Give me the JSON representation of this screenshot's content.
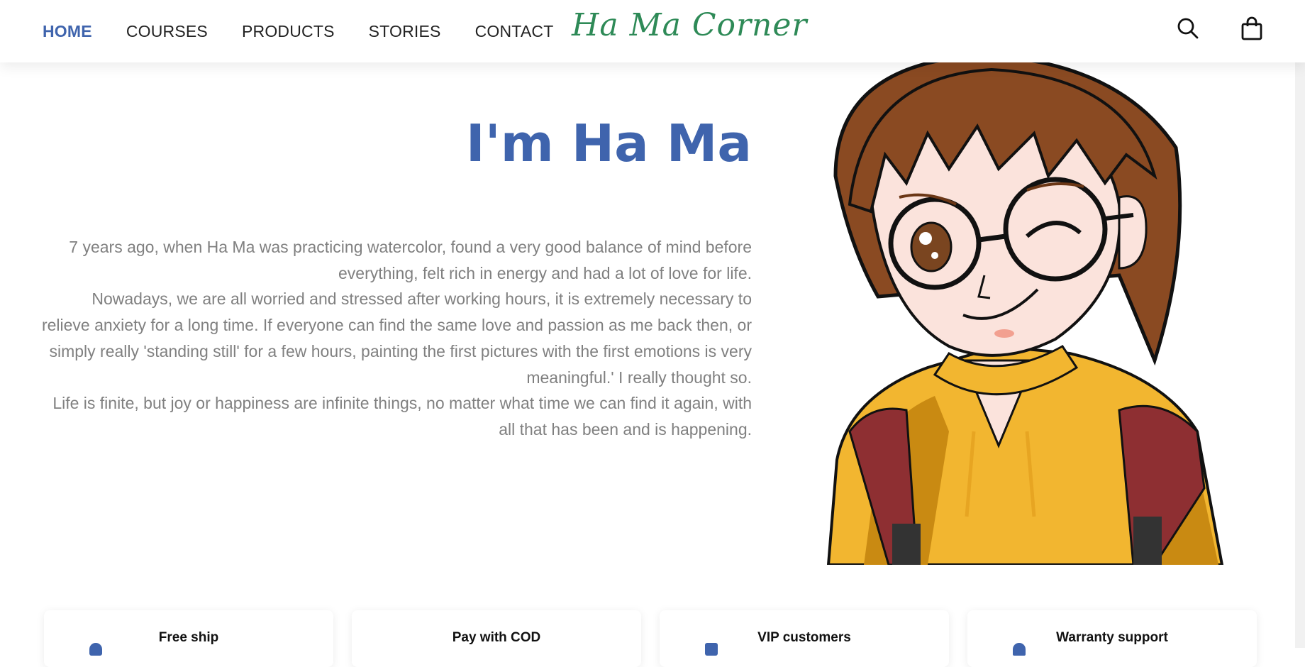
{
  "nav": {
    "items": [
      {
        "label": "HOME",
        "active": true
      },
      {
        "label": "COURSES"
      },
      {
        "label": "PRODUCTS"
      },
      {
        "label": "STORIES"
      },
      {
        "label": "CONTACT"
      }
    ]
  },
  "brand": {
    "logo_text": "Ha Ma Corner",
    "accent_color": "#3f64ad",
    "logo_color": "#2e8a57"
  },
  "header": {
    "icons": [
      "search-icon",
      "shopping-bag-icon"
    ]
  },
  "hero": {
    "title": "I'm Ha Ma",
    "paragraphs": [
      "7 years ago, when Ha Ma was practicing watercolor, found a very good balance of mind before everything, felt rich in energy and had a lot of love for life.",
      "Nowadays, we are all worried and stressed after working hours, it is extremely necessary to relieve anxiety for a long time. If everyone can find the same love and passion as me back then, or simply really 'standing still' for a few hours, painting the first pictures with the first emotions is very meaningful.' I really thought so.",
      "Life is finite, but joy or happiness are infinite things, no matter what time we can find it again, with all that has been and is happening."
    ]
  },
  "features": [
    {
      "title": "Free ship",
      "icon": "location-icon"
    },
    {
      "title": "Pay with COD",
      "icon": "wallet-icon"
    },
    {
      "title": "VIP customers",
      "icon": "card-icon"
    },
    {
      "title": "Warranty support",
      "icon": "heart-icon"
    }
  ]
}
